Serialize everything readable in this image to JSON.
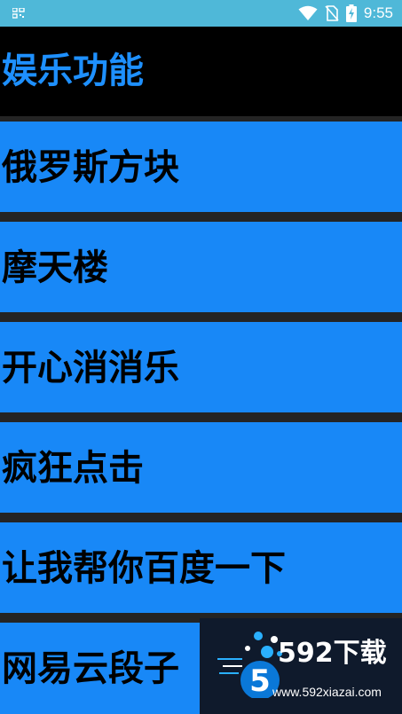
{
  "status_bar": {
    "time": "9:55",
    "icons": [
      "grid-notification-icon",
      "wifi-icon",
      "no-sim-icon",
      "battery-charging-icon"
    ]
  },
  "header": {
    "title": "娱乐功能"
  },
  "menu": {
    "items": [
      {
        "label": "俄罗斯方块"
      },
      {
        "label": "摩天楼"
      },
      {
        "label": "开心消消乐"
      },
      {
        "label": "疯狂点击"
      },
      {
        "label": "让我帮你百度一下"
      },
      {
        "label": "网易云段子"
      }
    ]
  },
  "watermark": {
    "brand": "592下载",
    "url": "www.592xiazai.com"
  },
  "colors": {
    "status_bar": "#4fb8d8",
    "header_bg": "#000000",
    "header_text": "#1e90ff",
    "item_bg": "#1888f7",
    "item_text": "#000000",
    "divider": "#242424"
  }
}
